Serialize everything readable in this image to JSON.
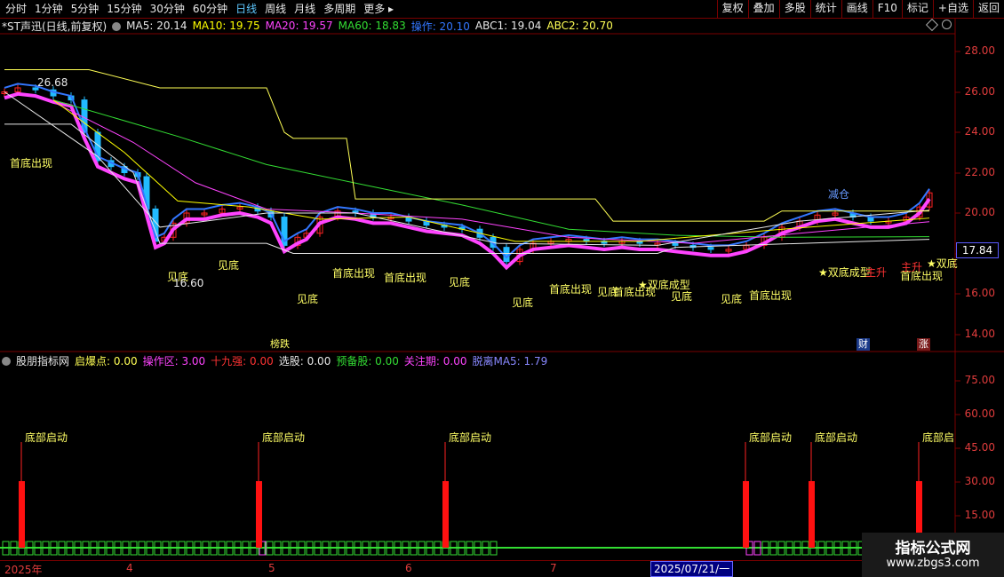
{
  "toolbar": {
    "periods": [
      "分时",
      "1分钟",
      "5分钟",
      "15分钟",
      "30分钟",
      "60分钟",
      "日线",
      "周线",
      "月线",
      "多周期",
      "更多 ▸"
    ],
    "active_period": "日线",
    "buttons": [
      "复权",
      "叠加",
      "多股",
      "统计",
      "画线",
      "F10",
      "标记",
      "+自选",
      "返回"
    ]
  },
  "main_legend": {
    "title": "*ST声迅(日线,前复权)",
    "items": [
      {
        "label": "MA5: 20.14",
        "color": "#e8e8e8"
      },
      {
        "label": "MA10: 19.75",
        "color": "#ffff00"
      },
      {
        "label": "MA20: 19.57",
        "color": "#ff44ff"
      },
      {
        "label": "MA60: 18.83",
        "color": "#33dd33"
      },
      {
        "label": "操作: 20.10",
        "color": "#3377ff"
      },
      {
        "label": "ABC1: 19.04",
        "color": "#e8e8e8"
      },
      {
        "label": "ABC2: 20.70",
        "color": "#ffff55"
      }
    ]
  },
  "price_axis": [
    "28.00",
    "26.00",
    "24.00",
    "22.00",
    "20.00",
    "18.00",
    "16.00",
    "14.00"
  ],
  "price_marker": "17.84",
  "high_label": "26.68",
  "low_label": "16.60",
  "main_annotations": [
    {
      "text": "首底出现",
      "color": "#ffff66"
    },
    {
      "text": "见底",
      "color": "#ffff66"
    },
    {
      "text": "见底",
      "color": "#ffff66"
    },
    {
      "text": "见底",
      "color": "#ffff66"
    },
    {
      "text": "首底出现",
      "color": "#ffff66"
    },
    {
      "text": "首底出现",
      "color": "#ffff66"
    },
    {
      "text": "见底",
      "color": "#ffff66"
    },
    {
      "text": "见底",
      "color": "#ffff66"
    },
    {
      "text": "首底出现",
      "color": "#ffff66"
    },
    {
      "text": "见底",
      "color": "#ffff66"
    },
    {
      "text": "首底出现",
      "color": "#ffff66"
    },
    {
      "text": "★双底成型",
      "color": "#ffff66"
    },
    {
      "text": "见底",
      "color": "#ffff66"
    },
    {
      "text": "见底",
      "color": "#ffff66"
    },
    {
      "text": "首底出现",
      "color": "#ffff66"
    },
    {
      "text": "减仓",
      "color": "#6699ff"
    },
    {
      "text": "★双底成型",
      "color": "#ffff66"
    },
    {
      "text": "主升",
      "color": "#ff3333"
    },
    {
      "text": "主升",
      "color": "#ff3333"
    },
    {
      "text": "★双底",
      "color": "#ffff66"
    },
    {
      "text": "首底出现",
      "color": "#ffff66"
    }
  ],
  "badges": {
    "rank": "榜跌",
    "cai": "财",
    "zhang": "涨"
  },
  "sub_legend": {
    "title": "股朋指标网",
    "items": [
      {
        "label": "启爆点: 0.00",
        "color": "#ffff55"
      },
      {
        "label": "操作区: 3.00",
        "color": "#ff44ff"
      },
      {
        "label": "十九强: 0.00",
        "color": "#ff3333"
      },
      {
        "label": "选股: 0.00",
        "color": "#e8e8e8"
      },
      {
        "label": "预备股: 0.00",
        "color": "#33dd33"
      },
      {
        "label": "关注期: 0.00",
        "color": "#ff44ff"
      },
      {
        "label": "脱离MA5: 1.79",
        "color": "#8888ff"
      }
    ]
  },
  "sub_axis": [
    "75.00",
    "60.00",
    "45.00",
    "30.00",
    "15.00"
  ],
  "signal_labels": [
    "底部启动",
    "底部启动",
    "底部启动",
    "底部启动",
    "底部启动",
    "底部启"
  ],
  "date_axis": [
    "2025年",
    "4",
    "5",
    "6",
    "7"
  ],
  "date_cursor": "2025/07/21/一",
  "watermark": {
    "title": "指标公式网",
    "url": "www.zbgs3.com"
  },
  "colors": {
    "up": "#ff2222",
    "down": "#22bbff",
    "grid": "#7a0000"
  }
}
